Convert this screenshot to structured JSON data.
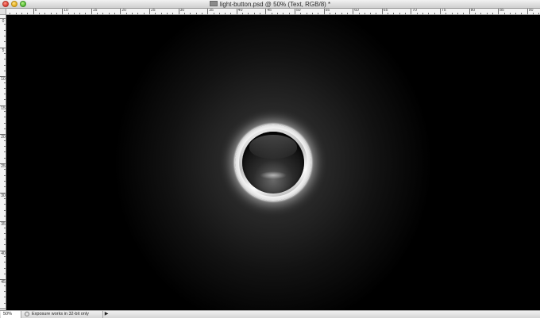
{
  "window": {
    "title": "light-button.psd @ 50% (Text, RGB/8) *"
  },
  "ruler_top": {
    "labels": [
      "0",
      "5",
      "10",
      "15",
      "20",
      "25",
      "30",
      "35",
      "40",
      "45",
      "50",
      "55",
      "60",
      "65",
      "70",
      "75",
      "80",
      "85",
      "90",
      "95"
    ]
  },
  "ruler_left": {
    "labels": [
      "0",
      "5",
      "10",
      "15",
      "20",
      "25",
      "30",
      "35",
      "40",
      "45"
    ]
  },
  "canvas": {
    "background_center_color": "#3a3a3a",
    "background_edge_color": "#000000"
  },
  "statusbar": {
    "zoom": "50%",
    "info_text": "Exposure works in 32-bit only",
    "menu_arrow": "▶"
  },
  "icons": {
    "doc": "document-icon",
    "status": "status-info-icon"
  }
}
